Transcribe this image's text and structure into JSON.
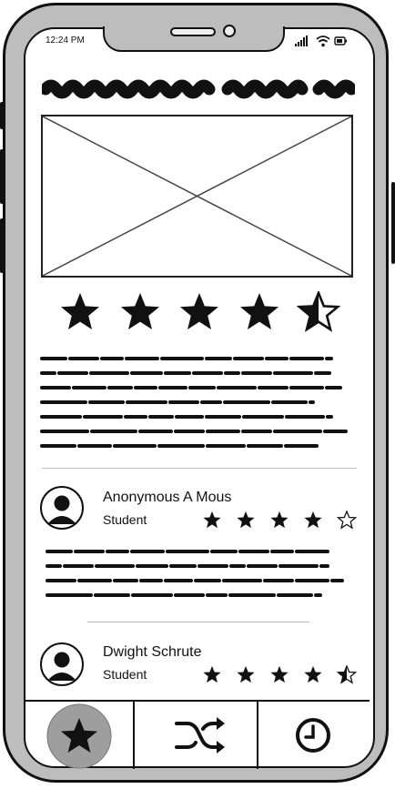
{
  "status_bar": {
    "time": "12:24 PM"
  },
  "content": {
    "rating": {
      "value": 4.5,
      "max": 5
    }
  },
  "reviews": [
    {
      "name": "Anonymous A Mous",
      "role": "Student",
      "rating": 4,
      "max": 5
    },
    {
      "name": "Dwight Schrute",
      "role": "Student",
      "rating": 4.5,
      "max": 5
    }
  ],
  "tabs": [
    {
      "icon": "star-icon",
      "active": true
    },
    {
      "icon": "shuffle-icon",
      "active": false
    },
    {
      "icon": "clock-icon",
      "active": false
    }
  ],
  "colors": {
    "frame": "#111111",
    "bezel": "#bdbdbd",
    "active_tab": "#9e9e9e"
  }
}
